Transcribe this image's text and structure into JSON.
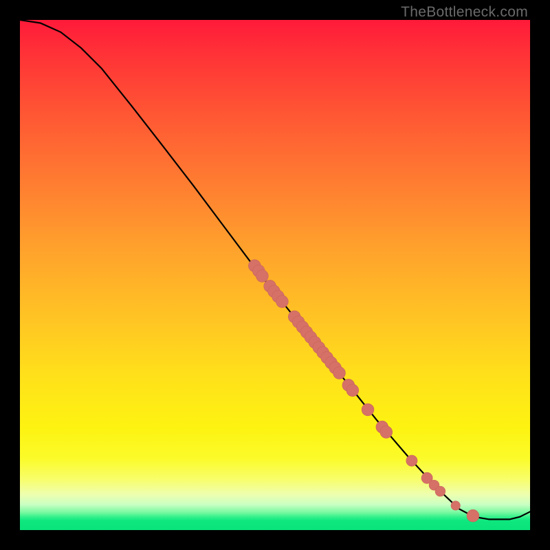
{
  "watermark": "TheBottleneck.com",
  "colors": {
    "background": "#000000",
    "curve": "#000000",
    "marker_fill": "#d57167",
    "marker_stroke": "#c9645b"
  },
  "chart_data": {
    "type": "line",
    "title": "",
    "xlabel": "",
    "ylabel": "",
    "xlim": [
      0,
      100
    ],
    "ylim": [
      0,
      100
    ],
    "curve": [
      {
        "x": 0,
        "y": 100
      },
      {
        "x": 4,
        "y": 99.4
      },
      {
        "x": 8,
        "y": 97.6
      },
      {
        "x": 12,
        "y": 94.5
      },
      {
        "x": 16,
        "y": 90.5
      },
      {
        "x": 22,
        "y": 83.0
      },
      {
        "x": 28,
        "y": 75.3
      },
      {
        "x": 34,
        "y": 67.5
      },
      {
        "x": 40,
        "y": 59.5
      },
      {
        "x": 46,
        "y": 51.5
      },
      {
        "x": 52,
        "y": 44.0
      },
      {
        "x": 58,
        "y": 36.5
      },
      {
        "x": 64,
        "y": 29.0
      },
      {
        "x": 70,
        "y": 21.5
      },
      {
        "x": 76,
        "y": 14.5
      },
      {
        "x": 82,
        "y": 8.0
      },
      {
        "x": 86,
        "y": 4.2
      },
      {
        "x": 89,
        "y": 2.6
      },
      {
        "x": 92,
        "y": 2.1
      },
      {
        "x": 96,
        "y": 2.1
      },
      {
        "x": 98,
        "y": 2.6
      },
      {
        "x": 100,
        "y": 3.6
      }
    ],
    "markers": [
      {
        "x": 46.0,
        "y": 51.8,
        "r": 1.2
      },
      {
        "x": 46.8,
        "y": 50.8,
        "r": 1.2
      },
      {
        "x": 47.5,
        "y": 49.8,
        "r": 1.2
      },
      {
        "x": 49.0,
        "y": 47.8,
        "r": 1.2
      },
      {
        "x": 49.8,
        "y": 46.8,
        "r": 1.2
      },
      {
        "x": 50.6,
        "y": 45.8,
        "r": 1.2
      },
      {
        "x": 51.4,
        "y": 44.8,
        "r": 1.2
      },
      {
        "x": 53.8,
        "y": 41.8,
        "r": 1.2
      },
      {
        "x": 54.6,
        "y": 40.8,
        "r": 1.2
      },
      {
        "x": 55.4,
        "y": 39.8,
        "r": 1.2
      },
      {
        "x": 56.2,
        "y": 38.8,
        "r": 1.2
      },
      {
        "x": 57.0,
        "y": 37.8,
        "r": 1.2
      },
      {
        "x": 57.8,
        "y": 36.8,
        "r": 1.2
      },
      {
        "x": 58.6,
        "y": 35.8,
        "r": 1.2
      },
      {
        "x": 59.4,
        "y": 34.8,
        "r": 1.2
      },
      {
        "x": 60.2,
        "y": 33.8,
        "r": 1.2
      },
      {
        "x": 61.0,
        "y": 32.8,
        "r": 1.2
      },
      {
        "x": 61.8,
        "y": 31.8,
        "r": 1.2
      },
      {
        "x": 62.6,
        "y": 30.8,
        "r": 1.2
      },
      {
        "x": 64.4,
        "y": 28.4,
        "r": 1.2
      },
      {
        "x": 65.2,
        "y": 27.4,
        "r": 1.2
      },
      {
        "x": 68.2,
        "y": 23.6,
        "r": 1.2
      },
      {
        "x": 71.0,
        "y": 20.2,
        "r": 1.2
      },
      {
        "x": 71.8,
        "y": 19.2,
        "r": 1.2
      },
      {
        "x": 76.8,
        "y": 13.6,
        "r": 1.1
      },
      {
        "x": 79.8,
        "y": 10.2,
        "r": 1.1
      },
      {
        "x": 81.2,
        "y": 8.8,
        "r": 1.0
      },
      {
        "x": 82.4,
        "y": 7.6,
        "r": 1.0
      },
      {
        "x": 85.4,
        "y": 4.8,
        "r": 0.9
      },
      {
        "x": 88.8,
        "y": 2.8,
        "r": 1.2
      }
    ]
  }
}
